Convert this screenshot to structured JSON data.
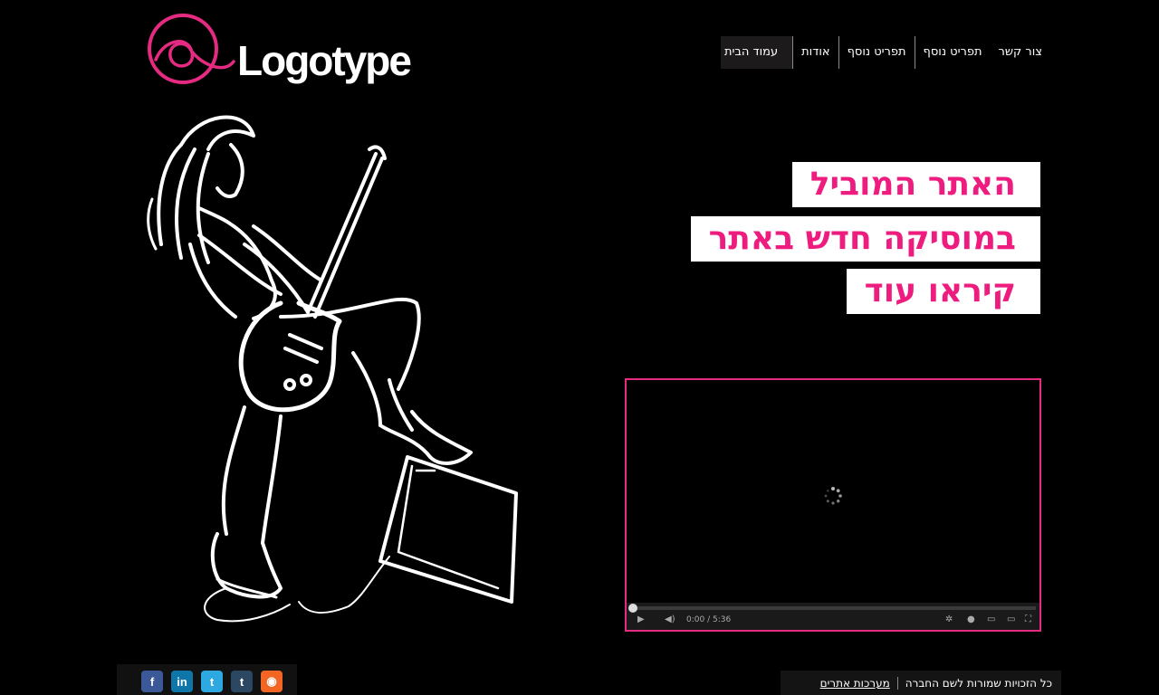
{
  "logo": {
    "text": "Logotype",
    "accent_color": "#e52a81"
  },
  "nav": {
    "items": [
      {
        "label": "עמוד הבית",
        "active": true
      },
      {
        "label": "אודות"
      },
      {
        "label": "תפריט נוסף"
      },
      {
        "label": "תפריט נוסף"
      },
      {
        "label": "צור קשר"
      }
    ]
  },
  "hero": {
    "lines": [
      "האתר המוביל",
      "במוסיקה חדש באתר",
      "קיראו עוד"
    ],
    "text_color": "#ee1c7e"
  },
  "video": {
    "border_color": "#e52a81",
    "time": "0:00 / 5:36"
  },
  "footer": {
    "copyright": "כל הזכויות שמורות לשם החברה",
    "credit": "מערכות אתרים",
    "social": [
      {
        "icon": "facebook-icon",
        "glyph": "f",
        "color": "#3b5998"
      },
      {
        "icon": "linkedin-icon",
        "glyph": "in",
        "color": "#0e76a8"
      },
      {
        "icon": "twitter-icon",
        "glyph": "t",
        "color": "#2ea8e0"
      },
      {
        "icon": "tumblr-icon",
        "glyph": "t",
        "color": "#2c4762"
      },
      {
        "icon": "rss-icon",
        "glyph": "◉",
        "color": "#f26522"
      }
    ]
  }
}
